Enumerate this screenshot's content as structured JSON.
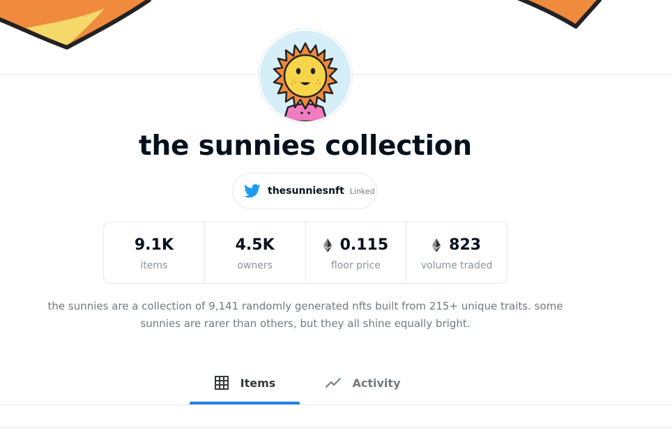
{
  "collection": {
    "title": "the sunnies collection",
    "description_line1": "the sunnies are a collection of 9,141 randomly generated nfts built from 215+ unique traits. some",
    "description_line2": "sunnies are rarer than others, but they all shine equally bright."
  },
  "social": {
    "twitter_handle": "thesunniesnft",
    "linked_label": "Linked",
    "icon": "twitter-icon",
    "brand_color": "#1d9bf0"
  },
  "stats": [
    {
      "value": "9.1K",
      "label": "items",
      "eth_icon": false
    },
    {
      "value": "4.5K",
      "label": "owners",
      "eth_icon": false
    },
    {
      "value": "0.115",
      "label": "floor price",
      "eth_icon": true
    },
    {
      "value": "823",
      "label": "volume traded",
      "eth_icon": true
    }
  ],
  "tabs": [
    {
      "label": "Items",
      "icon": "grid-icon",
      "active": true
    },
    {
      "label": "Activity",
      "icon": "activity-chart-icon",
      "active": false
    }
  ],
  "colors": {
    "accent": "#2081e2",
    "banner_orange": "#f08a3c",
    "banner_yellow": "#f4d86a",
    "sun_face": "#f6d54a",
    "sun_petals": "#f08a3c",
    "shirt": "#f07dbf"
  }
}
